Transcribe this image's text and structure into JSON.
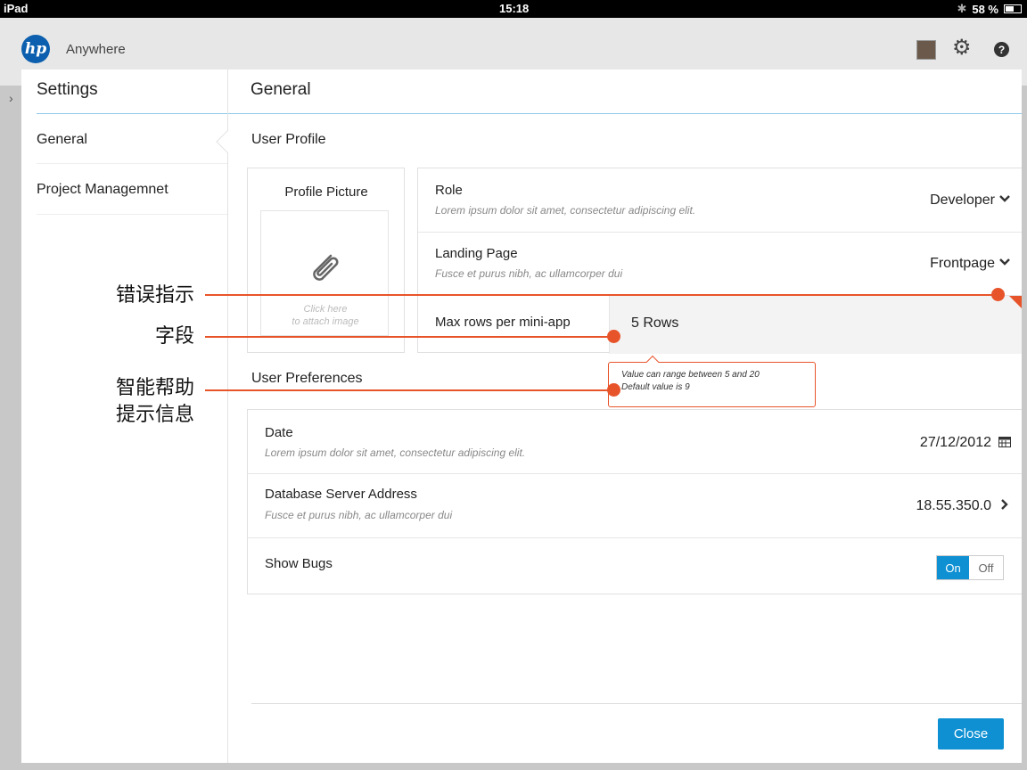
{
  "status_bar": {
    "device": "iPad",
    "time": "15:18",
    "bluetooth": "✱",
    "battery": "58 %"
  },
  "app_bar": {
    "logo_text": "hp",
    "app_name": "Anywhere",
    "gear_icon": "⚙",
    "help_icon": "?"
  },
  "sidebar": {
    "title": "Settings",
    "items": [
      {
        "label": "General"
      },
      {
        "label": "Project Managemnet"
      }
    ]
  },
  "main": {
    "title": "General",
    "user_profile": {
      "heading": "User Profile",
      "profile_picture": {
        "title": "Profile Picture",
        "hint_line1": "Click here",
        "hint_line2": "to attach image"
      },
      "role": {
        "label": "Role",
        "description": "Lorem ipsum dolor sit amet, consectetur adipiscing elit.",
        "value": "Developer"
      },
      "landing_page": {
        "label": "Landing Page",
        "description": "Fusce et purus nibh, ac ullamcorper dui",
        "value": "Frontpage"
      },
      "max_rows": {
        "label": "Max rows per mini-app",
        "value": "5 Rows"
      },
      "tooltip": {
        "line1": "Value can range between 5 and 20",
        "line2": "Default value is 9"
      }
    },
    "user_preferences": {
      "heading": "User Preferences",
      "date": {
        "label": "Date",
        "description": "Lorem ipsum dolor sit amet, consectetur adipiscing elit.",
        "value": "27/12/2012"
      },
      "db_server": {
        "label": "Database Server Address",
        "description": "Fusce et purus nibh, ac ullamcorper dui",
        "value": "18.55.350.0"
      },
      "show_bugs": {
        "label": "Show Bugs",
        "on_label": "On",
        "off_label": "Off",
        "state": "On"
      }
    },
    "close_label": "Close"
  },
  "annotations": {
    "error_indicator": "错误指示",
    "field": "字段",
    "smart_help_line1": "智能帮助",
    "smart_help_line2": "提示信息"
  },
  "colors": {
    "accent": "#0e90d2",
    "annotation": "#e8542a",
    "divider": "#8fc9ea"
  },
  "icons": {
    "chevron_down": "chevron-down-icon",
    "chevron_right": "chevron-right-icon",
    "calendar": "calendar-icon",
    "paperclip": "paperclip-icon"
  }
}
